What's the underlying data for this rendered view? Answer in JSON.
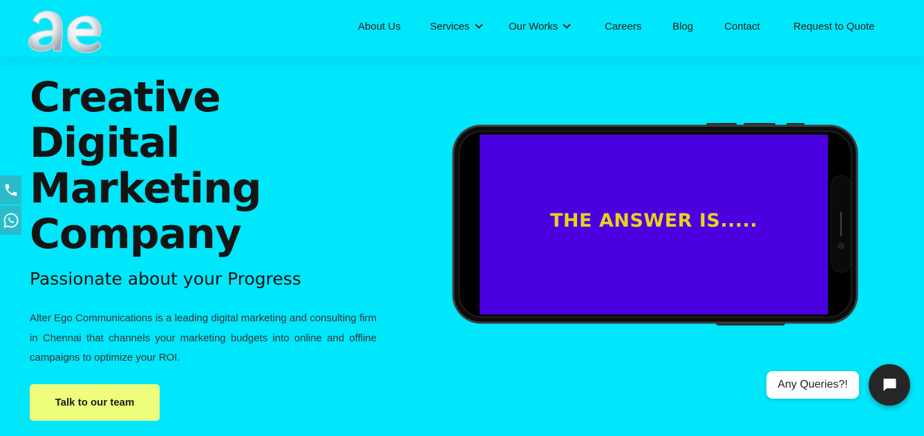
{
  "header": {
    "logo_text": "ae",
    "nav": [
      {
        "label": "About Us"
      },
      {
        "label": "Services",
        "icon": "chevron-down-icon"
      },
      {
        "label": "Our Works",
        "icon": "chevron-down-icon"
      },
      {
        "label": "Careers"
      },
      {
        "label": "Blog"
      },
      {
        "label": "Contact"
      },
      {
        "label": "Request to Quote"
      }
    ]
  },
  "hero": {
    "title_lines": [
      "Creative",
      "Digital",
      "Marketing",
      "Company"
    ],
    "subtitle": "Passionate about your Progress",
    "description": "Alter Ego Communications is a leading digital marketing and consulting firm in Chennai that channels your marketing budgets into online and offline campaigns to optimize your ROI.",
    "cta_label": "Talk to our team"
  },
  "side_contacts": [
    {
      "icon": "phone-icon"
    },
    {
      "icon": "whatsapp-icon"
    }
  ],
  "video": {
    "screen_text": "THE ANSWER IS....."
  },
  "chat": {
    "bubble_text": "Any Queries?!",
    "icon": "chat-icon"
  },
  "colors": {
    "background": "#00e6fb",
    "cta": "#eefe7c",
    "screen": "#4b00e0",
    "screen_text": "#e9d11f",
    "side_button": "#2bbccb",
    "chat_button": "#262626"
  }
}
